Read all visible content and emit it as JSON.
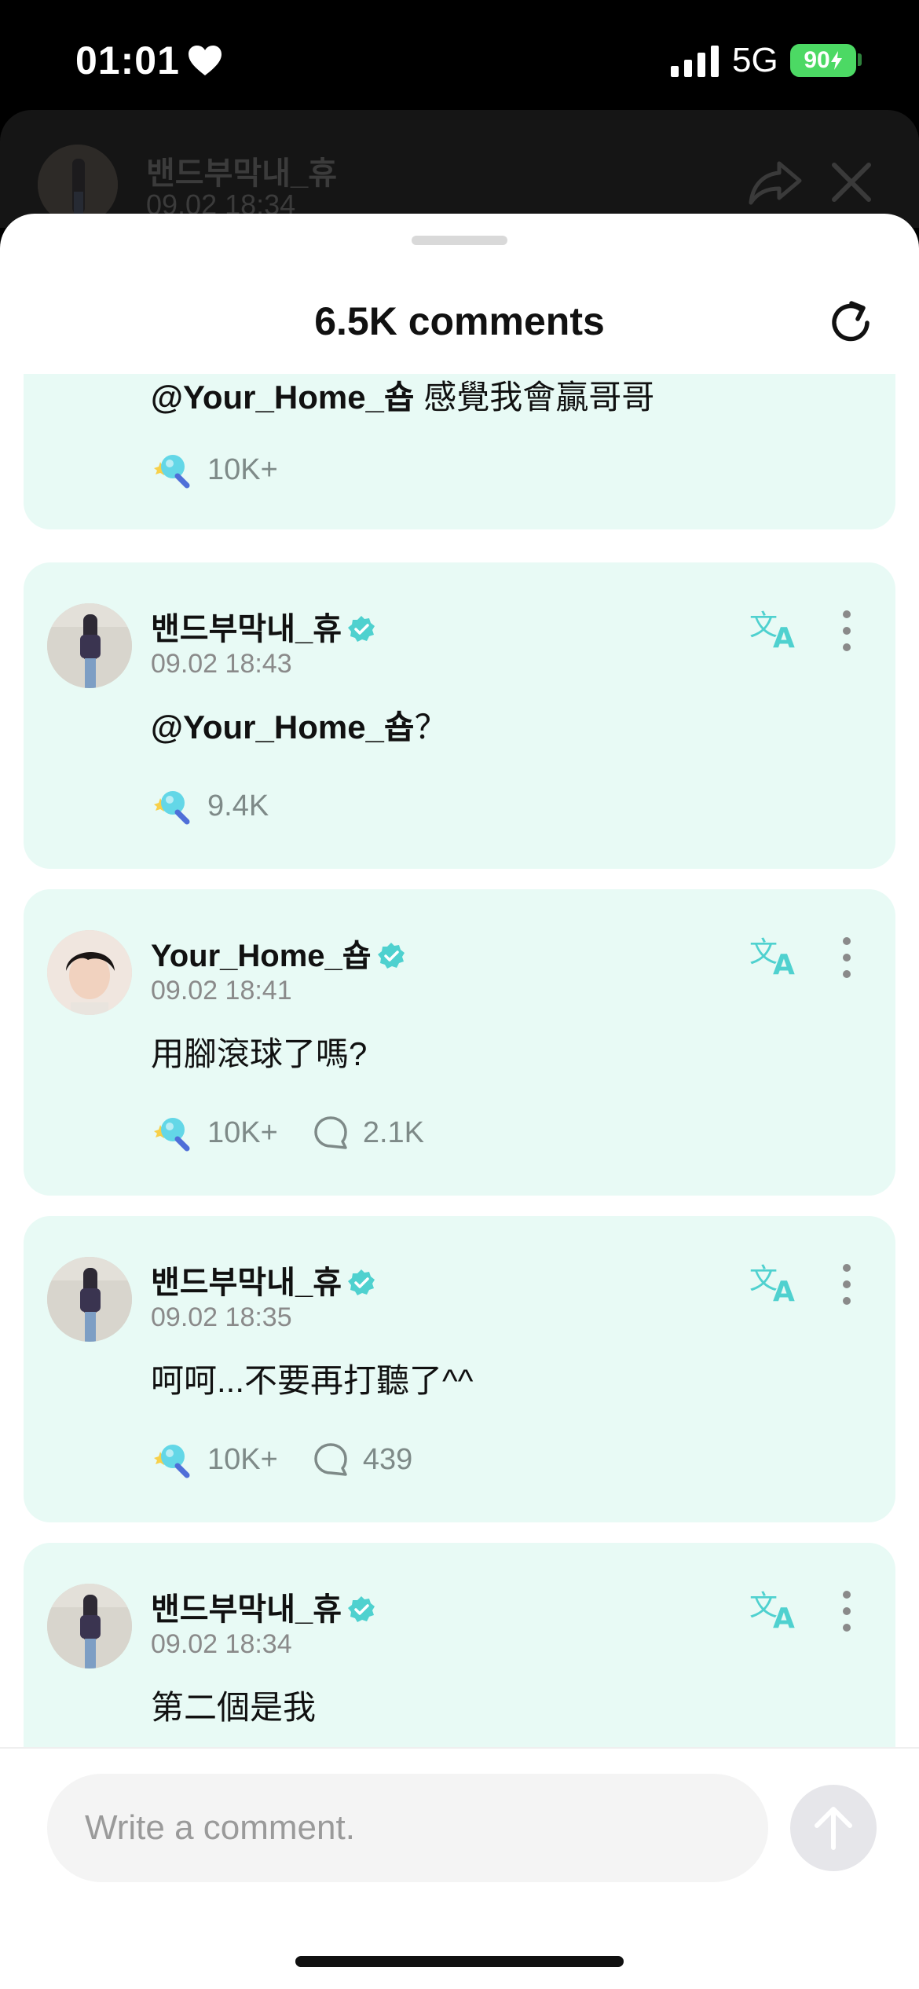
{
  "status": {
    "time": "01:01",
    "network": "5G",
    "battery": "90"
  },
  "background_post": {
    "author": "밴드부막내_휴",
    "date": "09.02 18:34"
  },
  "sheet": {
    "title": "6.5K comments"
  },
  "comments": [
    {
      "author": "",
      "date": "",
      "mention": "@Your_Home_숍",
      "text": " 感覺我會贏哥哥",
      "likes": "10K+",
      "replies": ""
    },
    {
      "author": "밴드부막내_휴",
      "date": "09.02 18:43",
      "mention": "@Your_Home_숍",
      "text": "？",
      "likes": "9.4K",
      "replies": ""
    },
    {
      "author": "Your_Home_숍",
      "date": "09.02 18:41",
      "mention": "",
      "text": "用腳滾球了嗎?",
      "likes": "10K+",
      "replies": "2.1K"
    },
    {
      "author": "밴드부막내_휴",
      "date": "09.02 18:35",
      "mention": "",
      "text": "呵呵...不要再打聽了^^",
      "likes": "10K+",
      "replies": "439"
    },
    {
      "author": "밴드부막내_휴",
      "date": "09.02 18:34",
      "mention": "",
      "text": "第二個是我",
      "likes": "",
      "replies": ""
    }
  ],
  "composer": {
    "placeholder": "Write a comment."
  },
  "colors": {
    "accent": "#4fd1cf",
    "card_bg": "#e8faf5",
    "battery": "#4cd964"
  },
  "icons": {
    "refresh": "refresh-icon",
    "translate": "translate-icon",
    "more": "more-vertical-icon",
    "verified": "verified-icon",
    "reaction": "lightstick-reaction-icon",
    "reply": "comment-bubble-icon",
    "send": "arrow-up-icon"
  }
}
